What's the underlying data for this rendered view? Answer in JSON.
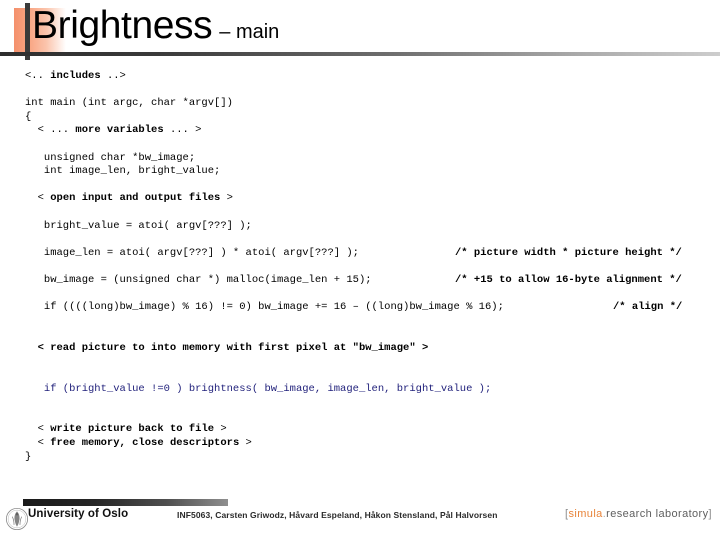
{
  "header": {
    "title": "Brightness",
    "subtitle": "– main",
    "accent_color": "#f4906b",
    "rule_color_dark": "#2e2e2e",
    "rule_color_light": "#cdcdcd"
  },
  "code": {
    "language": "c",
    "navy_color": "#1f1f7a",
    "lines": [
      {
        "text": "<.. includes ..>",
        "segments": [
          {
            "t": "<.. ",
            "bold": false
          },
          {
            "t": "includes",
            "bold": true
          },
          {
            "t": " ..>",
            "bold": false
          }
        ]
      },
      {
        "text": "",
        "blank": true
      },
      {
        "text": "int main (int argc, char *argv[])"
      },
      {
        "text": "{"
      },
      {
        "text": "  < ... more variables ... >",
        "segments": [
          {
            "t": "  < ... ",
            "bold": false
          },
          {
            "t": "more variables",
            "bold": true
          },
          {
            "t": " ... >",
            "bold": false
          }
        ]
      },
      {
        "text": "",
        "blank": true
      },
      {
        "text": "   unsigned char *bw_image;"
      },
      {
        "text": "   int image_len, bright_value;"
      },
      {
        "text": "",
        "blank": true
      },
      {
        "text": "  < open input and output files >",
        "segments": [
          {
            "t": "  < ",
            "bold": false
          },
          {
            "t": "open input and output files",
            "bold": true
          },
          {
            "t": " >",
            "bold": false
          }
        ]
      },
      {
        "text": "",
        "blank": true
      },
      {
        "text": "   bright_value = atoi( argv[???] );"
      },
      {
        "text": "",
        "blank": true
      },
      {
        "text": "   image_len = atoi( argv[???] ) * atoi( argv[???] );",
        "comment": "/* picture width * picture height */"
      },
      {
        "text": "",
        "blank": true
      },
      {
        "text": "   bw_image = (unsigned char *) malloc(image_len + 15);",
        "comment": "/* +15 to allow 16-byte alignment */"
      },
      {
        "text": "",
        "blank": true
      },
      {
        "text": "   if ((((long)bw_image) % 16) != 0) bw_image += 16 – ((long)bw_image % 16);",
        "comment": "/* align */"
      },
      {
        "text": "",
        "blank": true
      },
      {
        "text": "",
        "blank": true
      },
      {
        "text": "  < read picture to into memory with first pixel at \"bw_image\" >",
        "bold": true
      },
      {
        "text": "",
        "blank": true
      },
      {
        "text": "",
        "blank": true
      },
      {
        "text": "   if (bright_value !=0 ) brightness( bw_image, image_len, bright_value );",
        "navy": true
      },
      {
        "text": "",
        "blank": true
      },
      {
        "text": "",
        "blank": true
      },
      {
        "text": "  < write picture back to file >",
        "segments": [
          {
            "t": "  < ",
            "bold": false
          },
          {
            "t": "write picture back to file",
            "bold": true
          },
          {
            "t": " >",
            "bold": false
          }
        ]
      },
      {
        "text": "  < free memory, close descriptors >",
        "segments": [
          {
            "t": "  < ",
            "bold": false
          },
          {
            "t": "free memory, close descriptors",
            "bold": true
          },
          {
            "t": " >",
            "bold": false
          }
        ]
      },
      {
        "text": "}"
      }
    ],
    "comments": {
      "picture_size": "/* picture width * picture height */",
      "alignment_pad": "/* +15 to allow 16-byte alignment */",
      "align": "/* align */"
    }
  },
  "footer": {
    "university": "University of Oslo",
    "credits": "INF5063, Carsten Griwodz, Håvard Espeland, Håkon Stensland, Pål Halvorsen",
    "logo": {
      "open_bracket": "[",
      "brand": "simula",
      "dot": ".",
      "rest": "research laboratory",
      "close_bracket": "]",
      "brand_color": "#e8843a"
    }
  }
}
